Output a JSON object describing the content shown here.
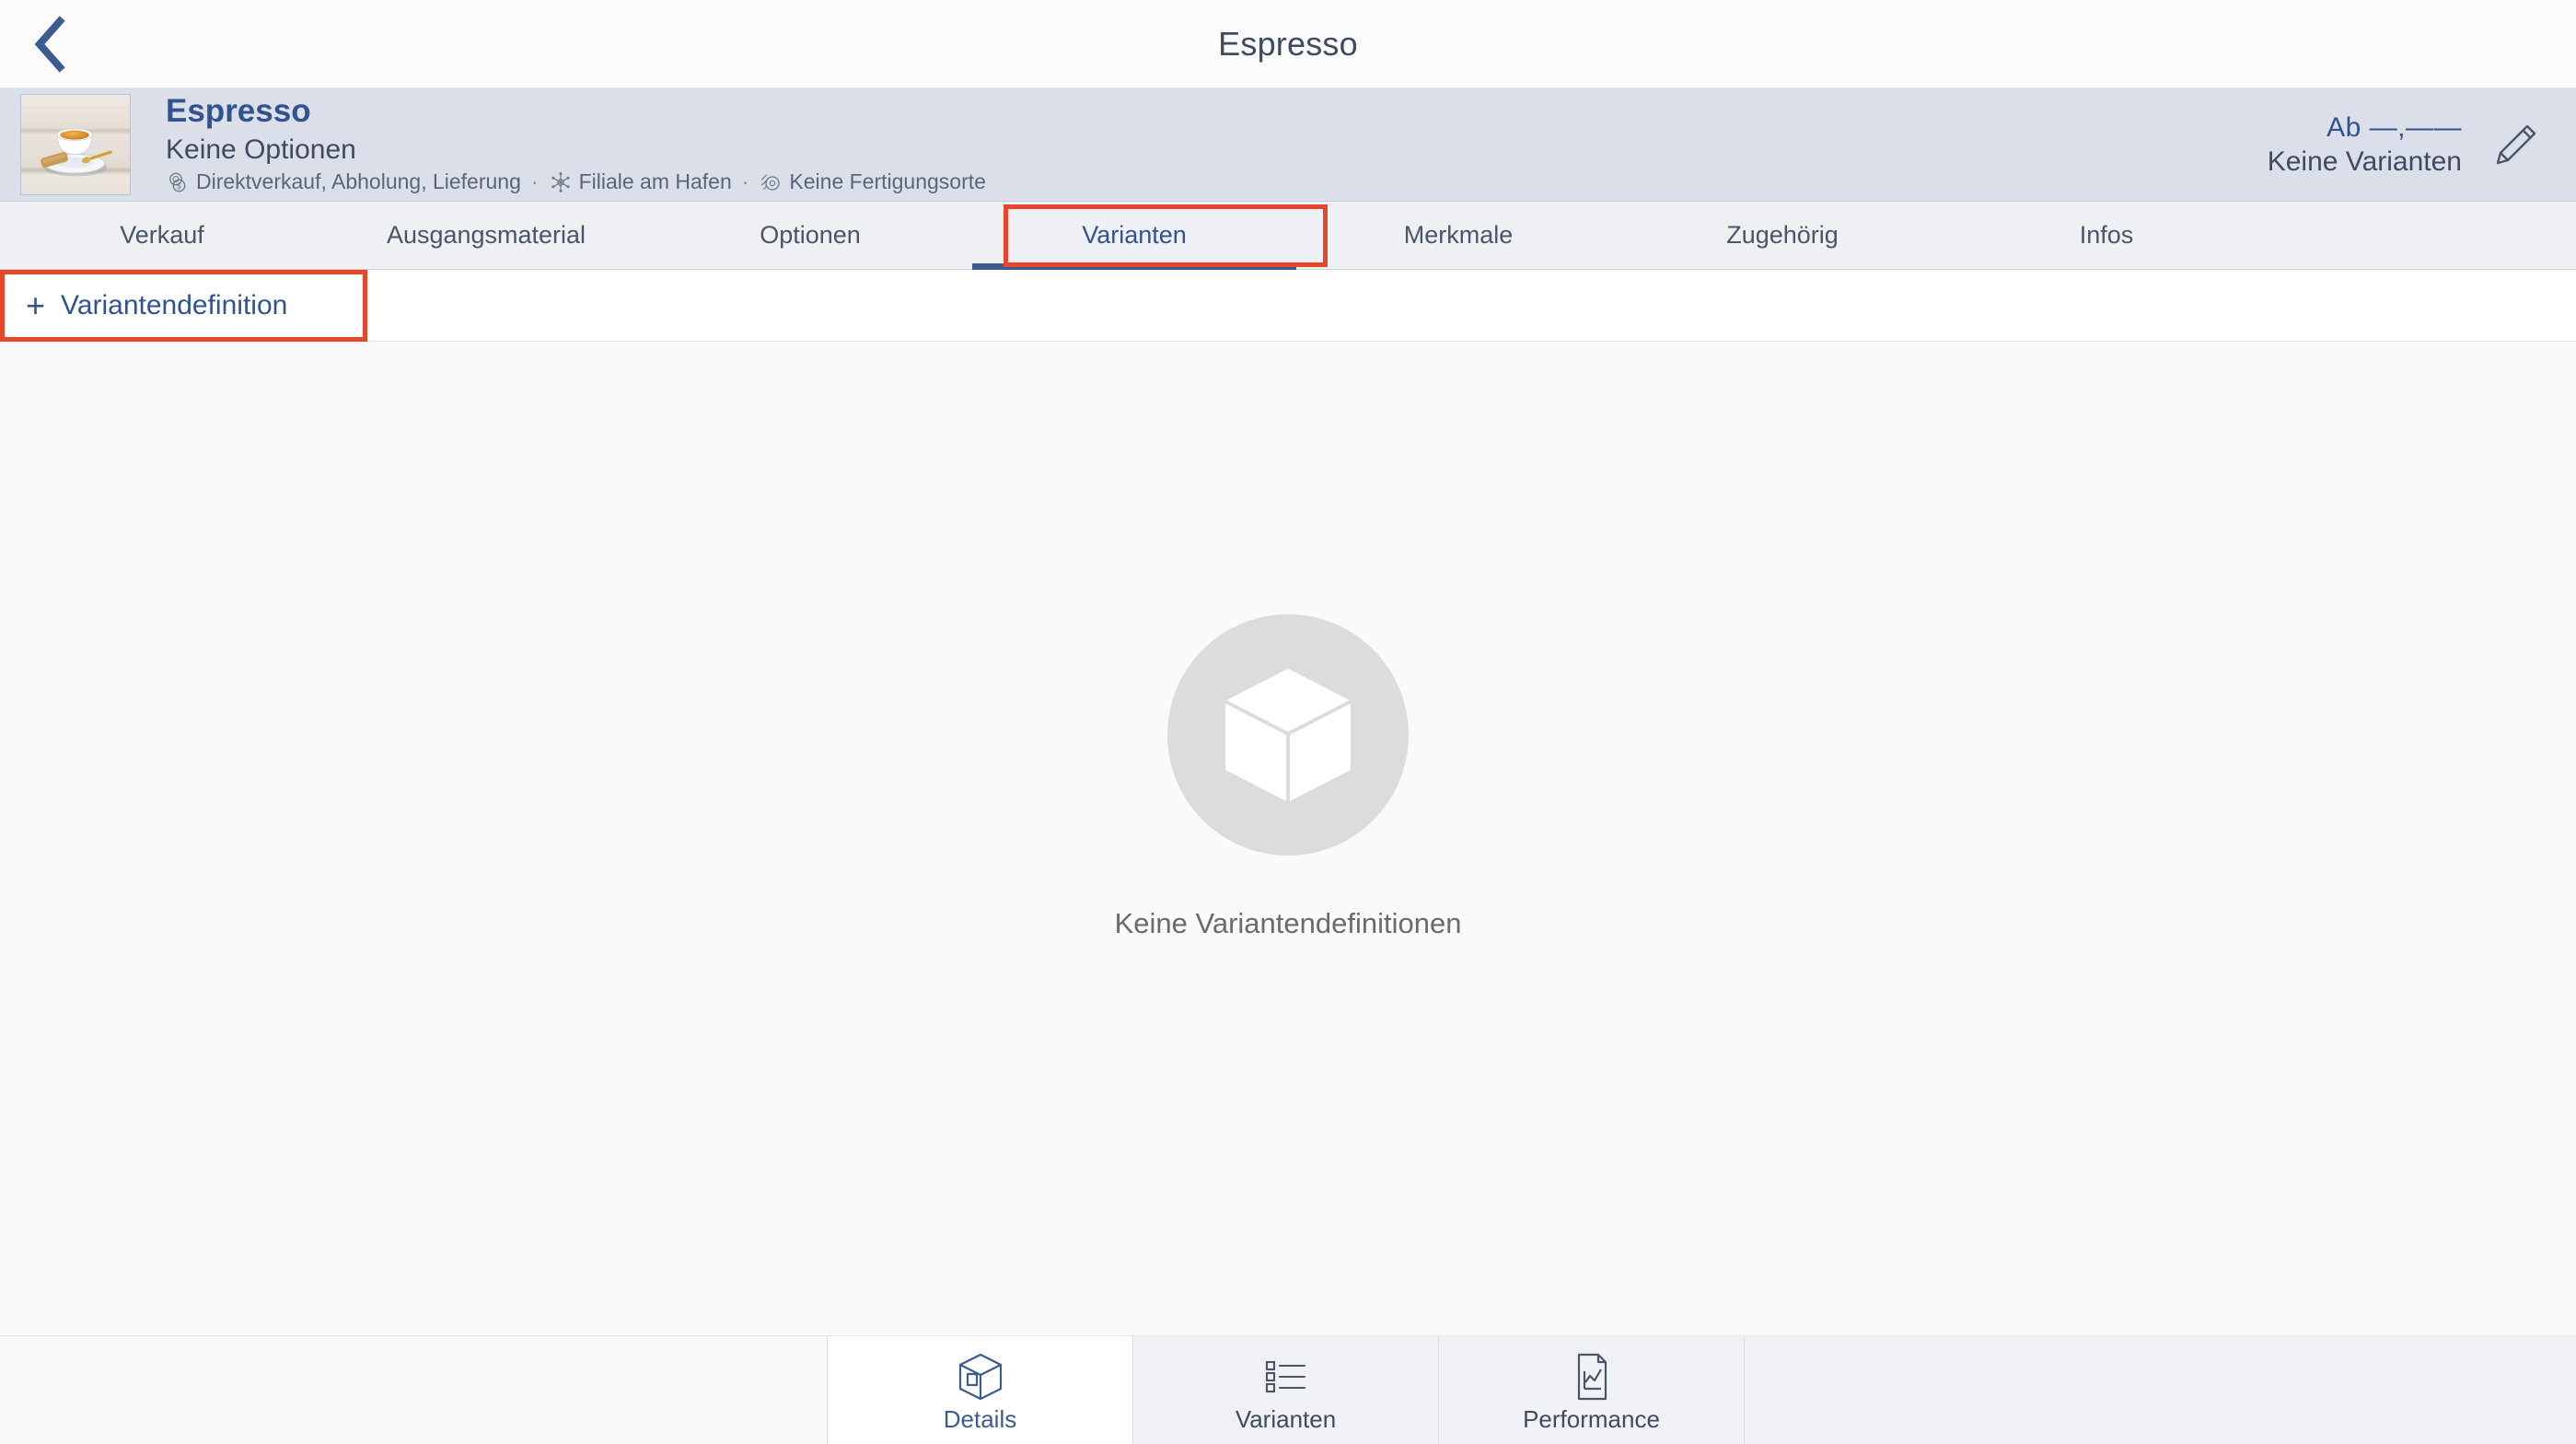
{
  "titlebar": {
    "back_icon": "chevron-left-icon",
    "title": "Espresso"
  },
  "object_header": {
    "thumbnail_alt": "espresso-cup-thumbnail",
    "title": "Espresso",
    "subtitle": "Keine Optionen",
    "meta": {
      "sales_icon": "coins-sales-icon",
      "sales_text": "Direktverkauf, Abholung, Lieferung",
      "separator_1": "·",
      "site_icon": "snowflake-site-icon",
      "site_text": "Filiale am Hafen",
      "separator_2": "·",
      "production_icon": "production-location-icon",
      "production_text": "Keine Fertigungsorte"
    },
    "price": "Ab —,——",
    "variants_status": "Keine Varianten",
    "edit_icon": "pencil-edit-icon"
  },
  "tabs": {
    "items": [
      {
        "label": "Verkauf",
        "active": false
      },
      {
        "label": "Ausgangsmaterial",
        "active": false
      },
      {
        "label": "Optionen",
        "active": false
      },
      {
        "label": "Varianten",
        "active": true
      },
      {
        "label": "Merkmale",
        "active": false
      },
      {
        "label": "Zugehörig",
        "active": false
      },
      {
        "label": "Infos",
        "active": false
      }
    ],
    "highlight_color": "#e8452a",
    "active_color": "#31538f"
  },
  "subtoolbar": {
    "add_icon": "plus-icon",
    "add_label": "Variantendefinition"
  },
  "empty_state": {
    "icon": "cube-box-icon",
    "message": "Keine Variantendefinitionen"
  },
  "bottom_nav": {
    "items": [
      {
        "label": "Details",
        "icon": "box-3d-icon",
        "active": true
      },
      {
        "label": "Varianten",
        "icon": "bulleted-list-icon",
        "active": false
      },
      {
        "label": "Performance",
        "icon": "document-chart-icon",
        "active": false
      }
    ]
  },
  "colors": {
    "accent_blue": "#31538f",
    "highlight_red": "#e8452a",
    "header_bg": "#dbdfe9",
    "tabstrip_bg": "#eef0f4",
    "content_bg": "#fafafa"
  }
}
